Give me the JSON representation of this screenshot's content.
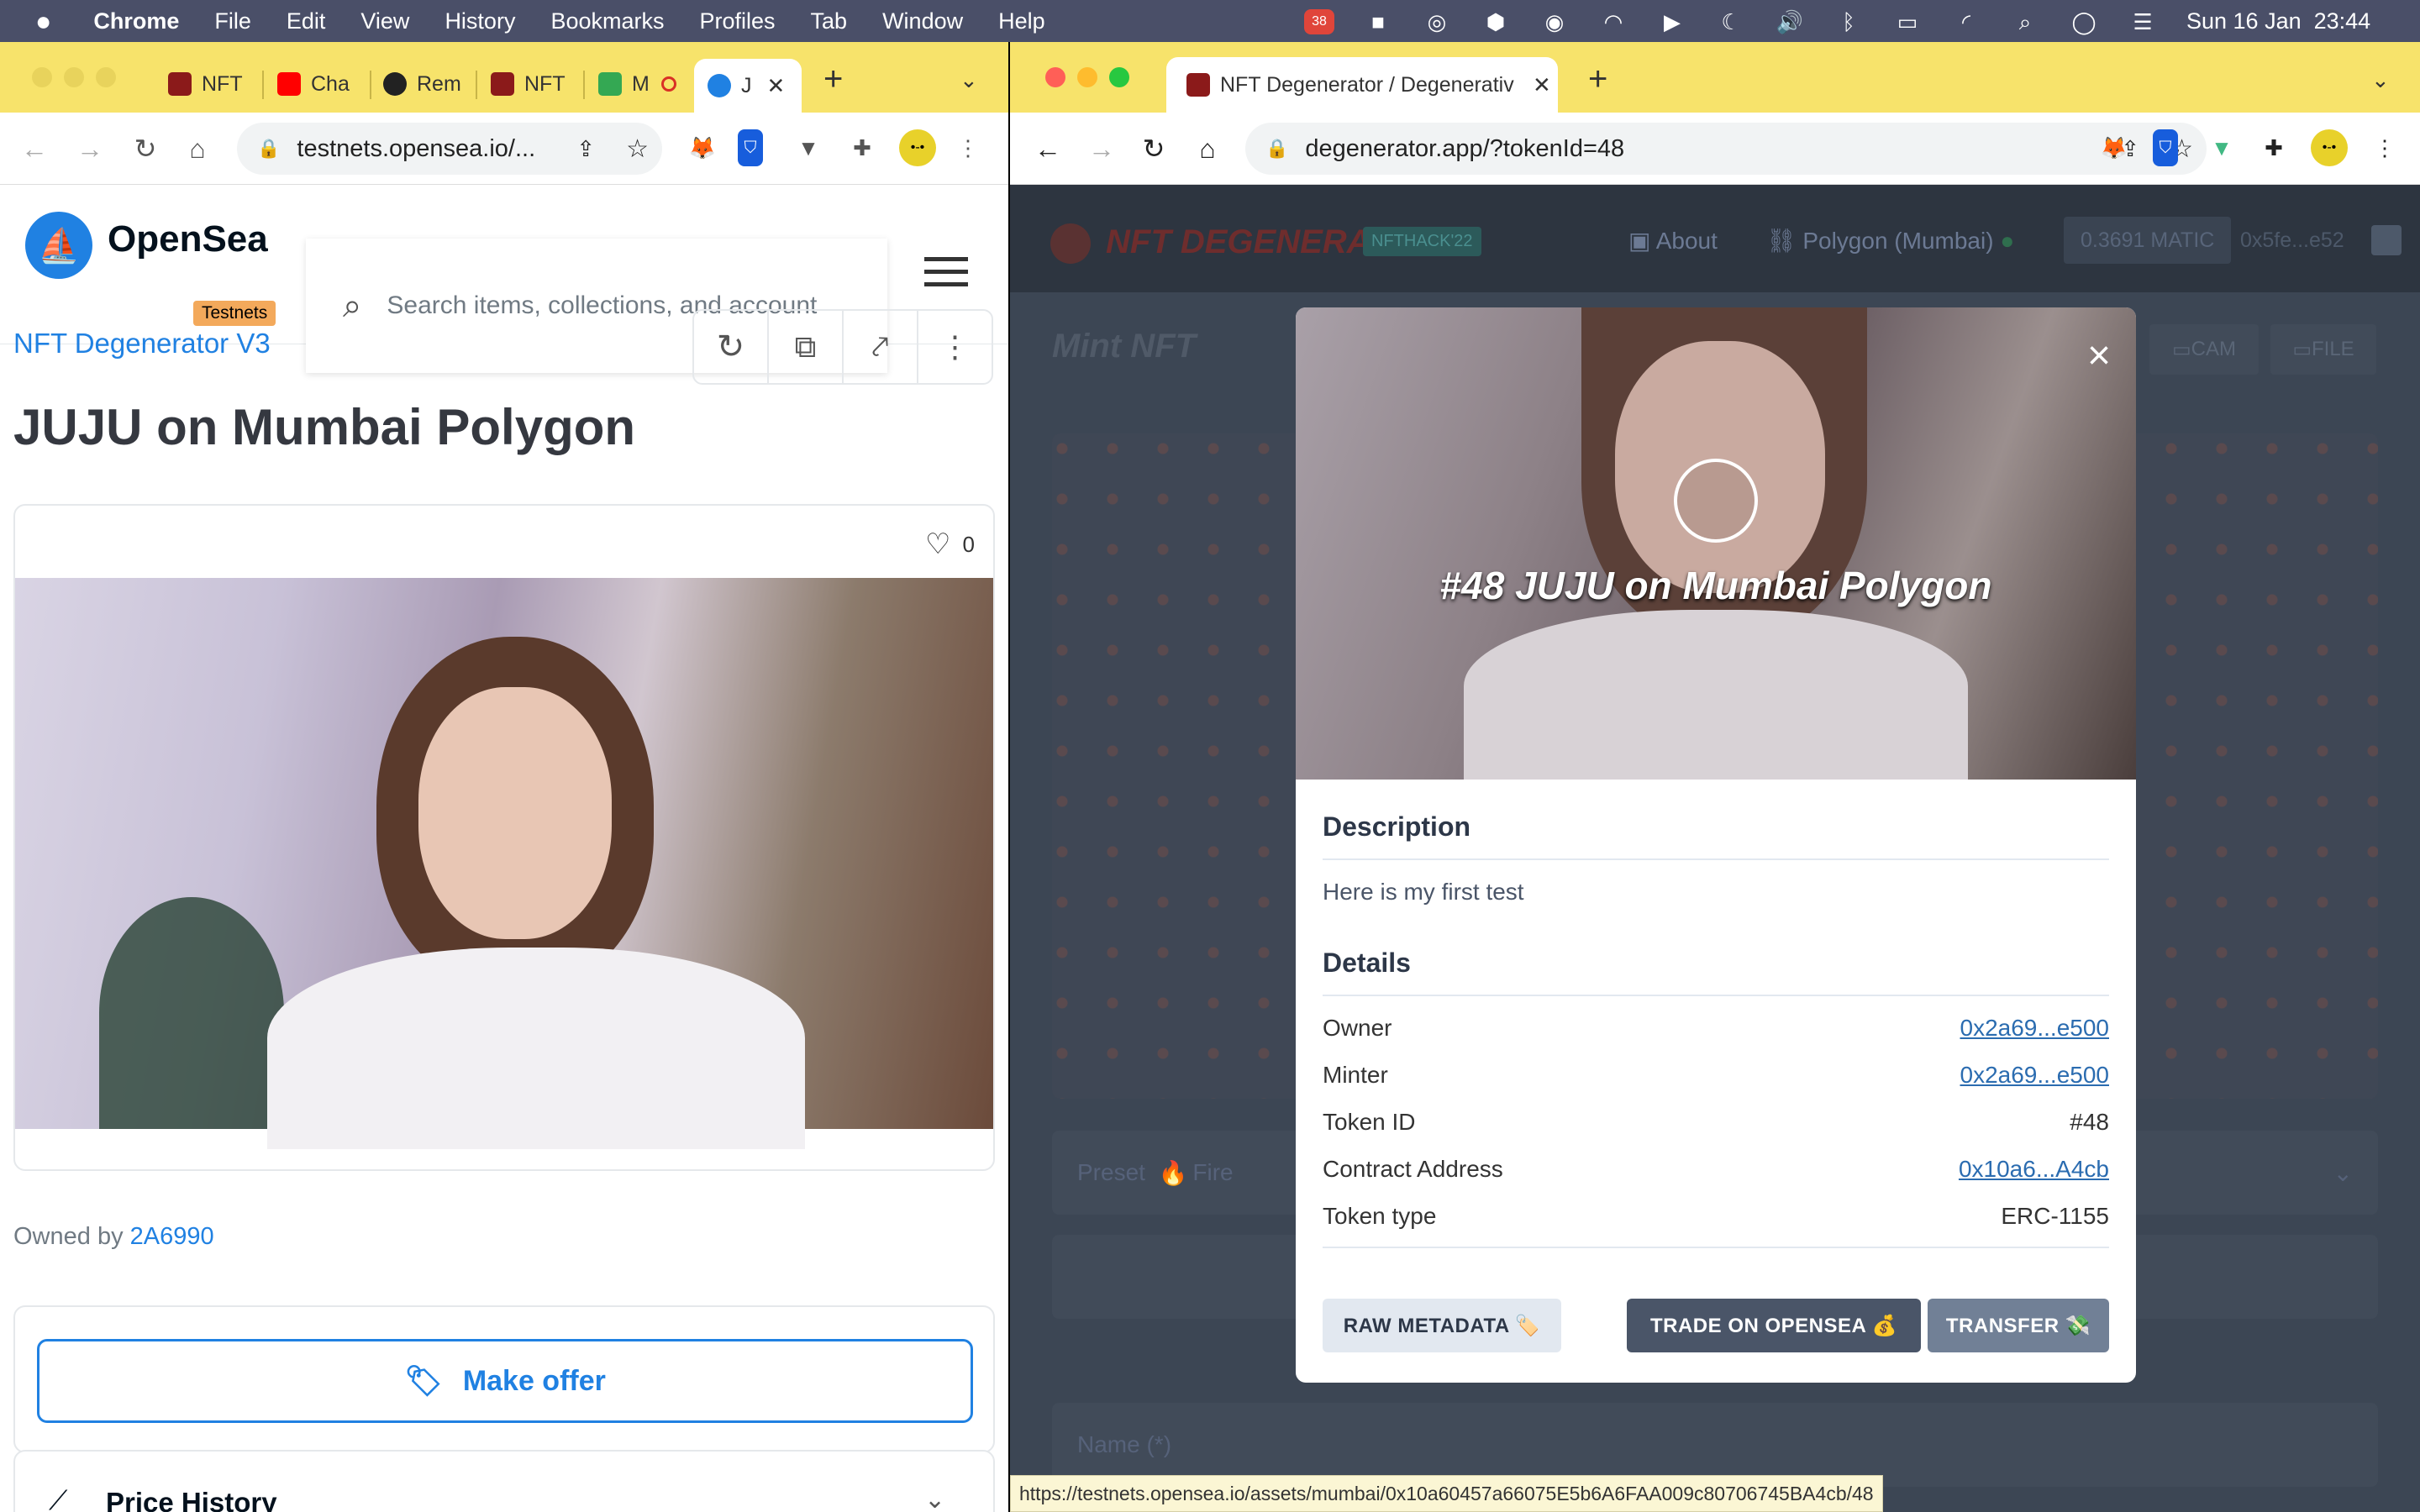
{
  "menubar": {
    "apple": "",
    "app": "Chrome",
    "items": [
      "File",
      "Edit",
      "View",
      "History",
      "Bookmarks",
      "Profiles",
      "Tab",
      "Window",
      "Help"
    ],
    "badge_count": "38",
    "datetime": "Sun 16 Jan  23:44"
  },
  "left": {
    "tabs": [
      "NFT",
      "Cha",
      "Rem",
      "NFT",
      "M",
      "J"
    ],
    "url": "testnets.opensea.io/...",
    "logo_text": "OpenSea",
    "logo_badge": "Testnets",
    "search_placeholder": "Search items, collections, and account",
    "collection": "NFT Degenerator V3",
    "title": "JUJU on Mumbai Polygon",
    "likes": "0",
    "owned_prefix": "Owned by",
    "owner": "2A6990",
    "make_offer": "Make offer",
    "price_history": "Price History"
  },
  "right": {
    "tab_title": "NFT Degenerator / Degenerativ",
    "url": "degenerator.app/?tokenId=48",
    "brand": "NFT DEGENERATOR",
    "brand_badge": "NFTHACK'22",
    "about": "About",
    "network": "Polygon (Mumbai)",
    "balance": "0.3691 MATIC",
    "address": "0x5fe...e52",
    "mint_title": "Mint NFT",
    "cam": "CAM",
    "file": "FILE",
    "preset_label": "Preset",
    "preset_value": "Fire",
    "name_placeholder": "Name (*)",
    "status_url": "https://testnets.opensea.io/assets/mumbai/0x10a60457a66075E5b6A6FAA009c80706745BA4cb/48",
    "modal": {
      "close": "×",
      "image_title": "#48 JUJU on Mumbai Polygon",
      "description_heading": "Description",
      "description": "Here is my first test",
      "details_heading": "Details",
      "details": [
        {
          "label": "Owner",
          "value": "0x2a69...e500",
          "link": true
        },
        {
          "label": "Minter",
          "value": "0x2a69...e500",
          "link": true
        },
        {
          "label": "Token ID",
          "value": "#48",
          "link": false
        },
        {
          "label": "Contract Address",
          "value": "0x10a6...A4cb",
          "link": true
        },
        {
          "label": "Token type",
          "value": "ERC-1155",
          "link": false
        }
      ],
      "raw_metadata": "RAW METADATA 🏷️",
      "trade": "TRADE  ON OPENSEA 💰",
      "transfer": "TRANSFER 💸"
    }
  },
  "colors": {
    "menubar": "#4a4f68",
    "tabbar": "#f7e36b",
    "opensea_blue": "#2081e2",
    "modal_btn_dark": "#4a5568",
    "modal_btn_light": "#e2e8f0"
  }
}
